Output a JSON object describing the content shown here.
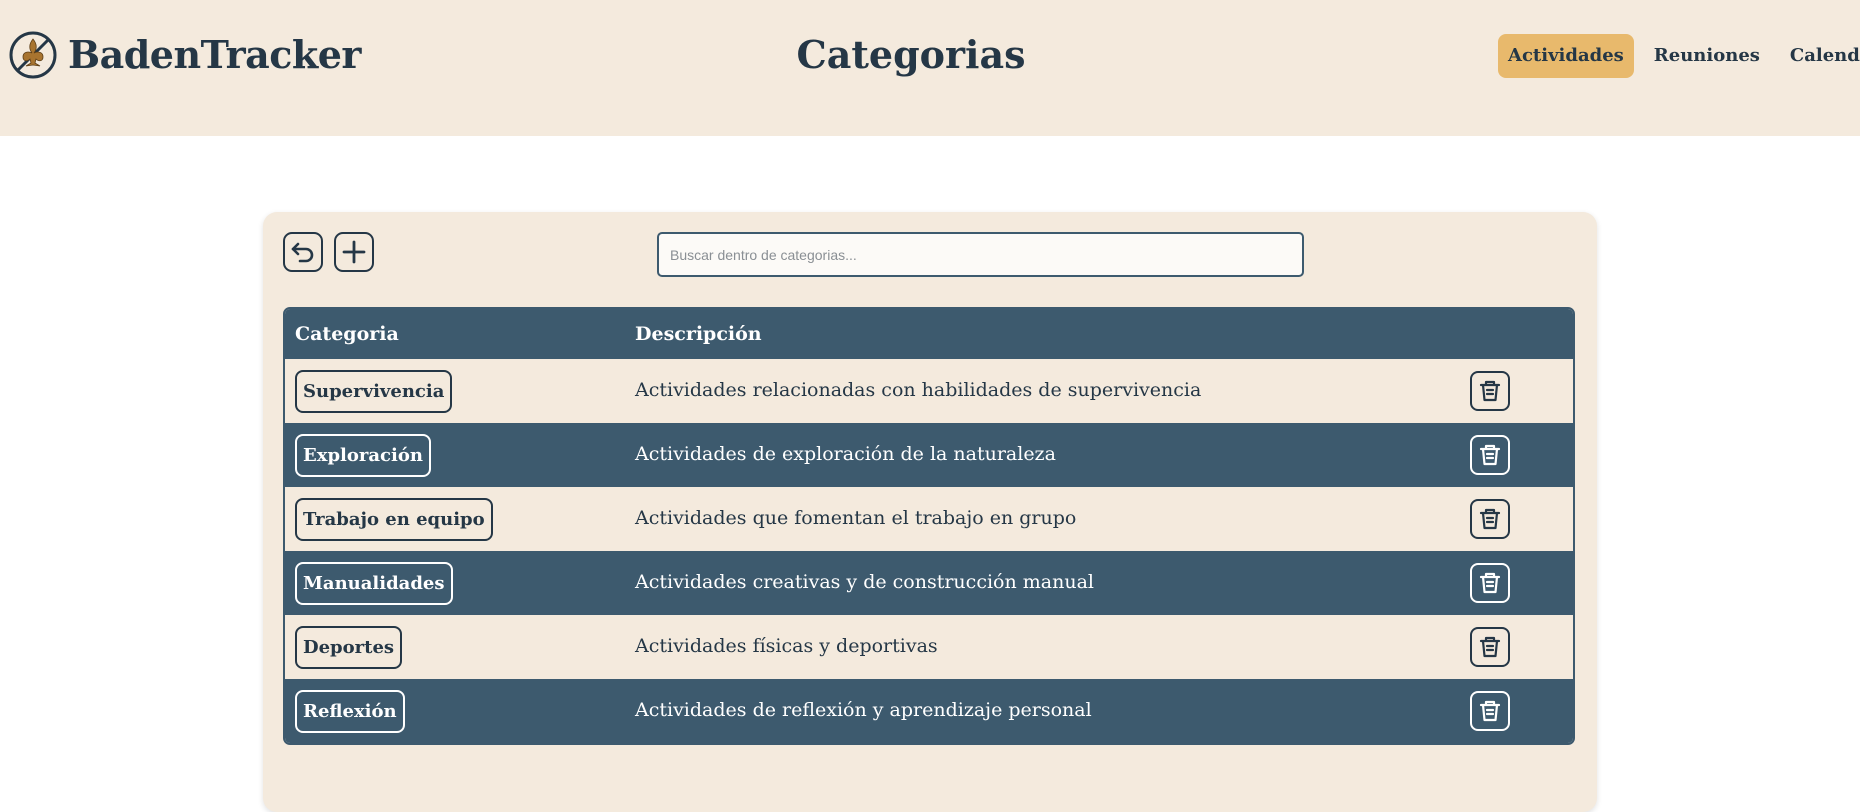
{
  "header": {
    "brand": "BadenTracker",
    "title": "Categorias",
    "nav": [
      {
        "label": "Actividades",
        "active": true
      },
      {
        "label": "Reuniones",
        "active": false
      },
      {
        "label": "Calendario",
        "active": false
      }
    ]
  },
  "toolbar": {
    "back_icon": "undo-arrow-icon",
    "add_icon": "plus-icon",
    "search_placeholder": "Buscar dentro de categorias..."
  },
  "table": {
    "headers": [
      "Categoria",
      "Descripción"
    ],
    "rows": [
      {
        "category": "Supervivencia",
        "description": "Actividades relacionadas con habilidades de supervivencia"
      },
      {
        "category": "Exploración",
        "description": "Actividades de exploración de la naturaleza"
      },
      {
        "category": "Trabajo en equipo",
        "description": "Actividades que fomentan el trabajo en grupo"
      },
      {
        "category": "Manualidades",
        "description": "Actividades creativas y de construcción manual"
      },
      {
        "category": "Deportes",
        "description": "Actividades físicas y deportivas"
      },
      {
        "category": "Reflexión",
        "description": "Actividades de reflexión y aprendizaje personal"
      }
    ],
    "delete_icon": "trash-icon"
  },
  "colors": {
    "header_bg": "#f4eadd",
    "primary": "#3d5a6e",
    "accent": "#e8b96c",
    "text": "#253746"
  }
}
